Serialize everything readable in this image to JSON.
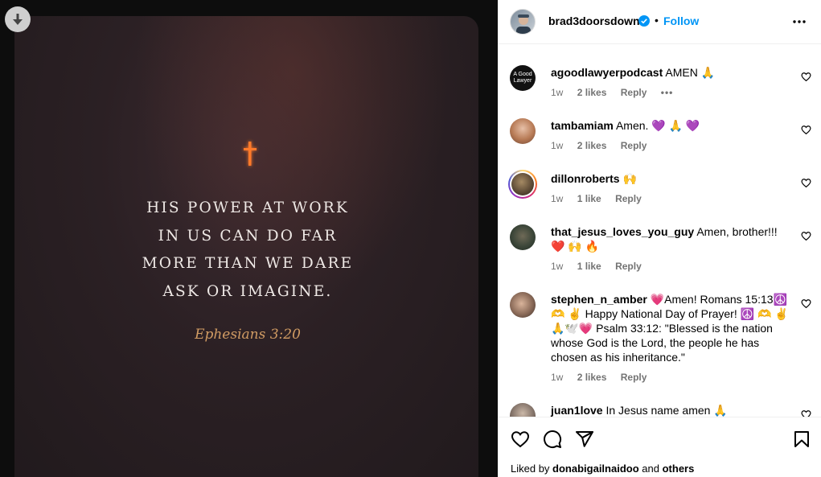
{
  "post": {
    "verse_lines": [
      "HIS POWER AT WORK",
      "IN US CAN DO FAR",
      "MORE THAN WE DARE",
      "ASK OR IMAGINE."
    ],
    "reference": "Ephesians 3:20"
  },
  "header": {
    "username": "brad3doorsdown",
    "separator": "•",
    "follow_label": "Follow"
  },
  "comments": [
    {
      "user": "agoodlawyerpodcast",
      "text": "AMEN 🙏",
      "time": "1w",
      "likes": "2 likes",
      "reply": "Reply",
      "more": "•••",
      "avatar_text": "A Good Lawyer"
    },
    {
      "user": "tambamiam",
      "text": "Amen. 💜 🙏 💜",
      "time": "1w",
      "likes": "2 likes",
      "reply": "Reply"
    },
    {
      "user": "dillonroberts",
      "text": "🙌",
      "time": "1w",
      "likes": "1 like",
      "reply": "Reply"
    },
    {
      "user": "that_jesus_loves_you_guy",
      "text": "Amen, brother!!! ❤️ 🙌 🔥",
      "time": "1w",
      "likes": "1 like",
      "reply": "Reply"
    },
    {
      "user": "stephen_n_amber",
      "text": "💗Amen! Romans 15:13☮️ 🫶 ✌️ Happy National Day of Prayer! ☮️ 🫶 ✌️ 🙏🕊️💗 Psalm 33:12: \"Blessed is the nation whose God is the Lord, the people he has chosen as his inheritance.\"",
      "time": "1w",
      "likes": "2 likes",
      "reply": "Reply"
    },
    {
      "user": "juan1love",
      "text": "In Jesus name amen 🙏"
    }
  ],
  "footer": {
    "liked_prefix": "Liked by",
    "liked_user": "donabigailnaidoo",
    "liked_and": "and",
    "liked_others": "others"
  },
  "colors": {
    "follow": "#0095f6",
    "verified": "#0095f6",
    "meta_text": "#737373",
    "reference": "#d09b63"
  }
}
